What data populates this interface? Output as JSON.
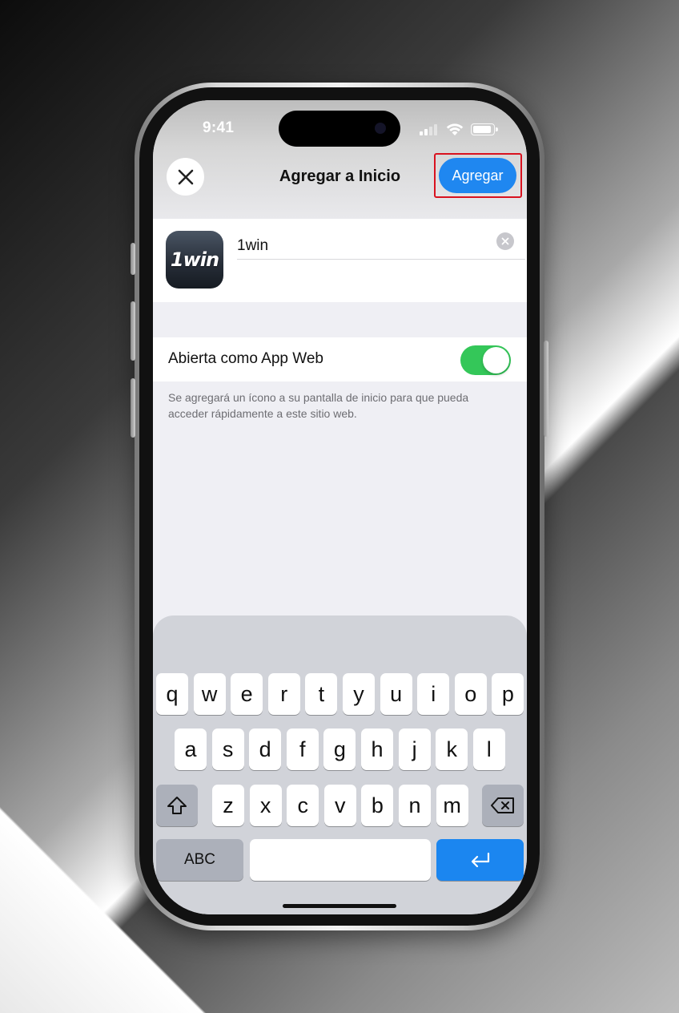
{
  "status_bar": {
    "time": "9:41"
  },
  "nav": {
    "title": "Agregar a Inicio",
    "add_label": "Agregar",
    "close_icon": "xmark-icon"
  },
  "app": {
    "icon_text": "1win",
    "name_value": "1win",
    "clear_icon": "xmark-circle-icon"
  },
  "web_app": {
    "label": "Abierta como App Web",
    "enabled": true,
    "footnote": "Se agregará un ícono a su pantalla de inicio para que pueda acceder rápidamente a este sitio web."
  },
  "keyboard": {
    "row1": [
      "q",
      "w",
      "e",
      "r",
      "t",
      "y",
      "u",
      "i",
      "o",
      "p"
    ],
    "row2": [
      "a",
      "s",
      "d",
      "f",
      "g",
      "h",
      "j",
      "k",
      "l"
    ],
    "row3": [
      "z",
      "x",
      "c",
      "v",
      "b",
      "n",
      "m"
    ],
    "abc_label": "ABC",
    "shift_icon": "shift-icon",
    "delete_icon": "delete-backward-icon",
    "return_icon": "return-icon"
  },
  "colors": {
    "accent": "#1f87f0",
    "toggle_on": "#34c759",
    "highlight": "#d9121f"
  }
}
